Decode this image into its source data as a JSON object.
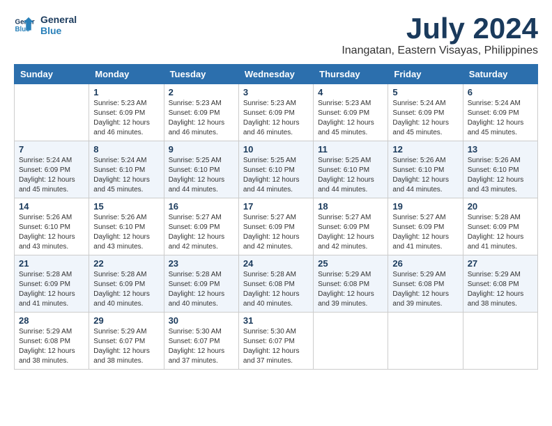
{
  "header": {
    "logo_line1": "General",
    "logo_line2": "Blue",
    "month": "July 2024",
    "location": "Inangatan, Eastern Visayas, Philippines"
  },
  "weekdays": [
    "Sunday",
    "Monday",
    "Tuesday",
    "Wednesday",
    "Thursday",
    "Friday",
    "Saturday"
  ],
  "weeks": [
    [
      {
        "day": "",
        "sunrise": "",
        "sunset": "",
        "daylight": ""
      },
      {
        "day": "1",
        "sunrise": "Sunrise: 5:23 AM",
        "sunset": "Sunset: 6:09 PM",
        "daylight": "Daylight: 12 hours and 46 minutes."
      },
      {
        "day": "2",
        "sunrise": "Sunrise: 5:23 AM",
        "sunset": "Sunset: 6:09 PM",
        "daylight": "Daylight: 12 hours and 46 minutes."
      },
      {
        "day": "3",
        "sunrise": "Sunrise: 5:23 AM",
        "sunset": "Sunset: 6:09 PM",
        "daylight": "Daylight: 12 hours and 46 minutes."
      },
      {
        "day": "4",
        "sunrise": "Sunrise: 5:23 AM",
        "sunset": "Sunset: 6:09 PM",
        "daylight": "Daylight: 12 hours and 45 minutes."
      },
      {
        "day": "5",
        "sunrise": "Sunrise: 5:24 AM",
        "sunset": "Sunset: 6:09 PM",
        "daylight": "Daylight: 12 hours and 45 minutes."
      },
      {
        "day": "6",
        "sunrise": "Sunrise: 5:24 AM",
        "sunset": "Sunset: 6:09 PM",
        "daylight": "Daylight: 12 hours and 45 minutes."
      }
    ],
    [
      {
        "day": "7",
        "sunrise": "Sunrise: 5:24 AM",
        "sunset": "Sunset: 6:09 PM",
        "daylight": "Daylight: 12 hours and 45 minutes."
      },
      {
        "day": "8",
        "sunrise": "Sunrise: 5:24 AM",
        "sunset": "Sunset: 6:10 PM",
        "daylight": "Daylight: 12 hours and 45 minutes."
      },
      {
        "day": "9",
        "sunrise": "Sunrise: 5:25 AM",
        "sunset": "Sunset: 6:10 PM",
        "daylight": "Daylight: 12 hours and 44 minutes."
      },
      {
        "day": "10",
        "sunrise": "Sunrise: 5:25 AM",
        "sunset": "Sunset: 6:10 PM",
        "daylight": "Daylight: 12 hours and 44 minutes."
      },
      {
        "day": "11",
        "sunrise": "Sunrise: 5:25 AM",
        "sunset": "Sunset: 6:10 PM",
        "daylight": "Daylight: 12 hours and 44 minutes."
      },
      {
        "day": "12",
        "sunrise": "Sunrise: 5:26 AM",
        "sunset": "Sunset: 6:10 PM",
        "daylight": "Daylight: 12 hours and 44 minutes."
      },
      {
        "day": "13",
        "sunrise": "Sunrise: 5:26 AM",
        "sunset": "Sunset: 6:10 PM",
        "daylight": "Daylight: 12 hours and 43 minutes."
      }
    ],
    [
      {
        "day": "14",
        "sunrise": "Sunrise: 5:26 AM",
        "sunset": "Sunset: 6:10 PM",
        "daylight": "Daylight: 12 hours and 43 minutes."
      },
      {
        "day": "15",
        "sunrise": "Sunrise: 5:26 AM",
        "sunset": "Sunset: 6:10 PM",
        "daylight": "Daylight: 12 hours and 43 minutes."
      },
      {
        "day": "16",
        "sunrise": "Sunrise: 5:27 AM",
        "sunset": "Sunset: 6:09 PM",
        "daylight": "Daylight: 12 hours and 42 minutes."
      },
      {
        "day": "17",
        "sunrise": "Sunrise: 5:27 AM",
        "sunset": "Sunset: 6:09 PM",
        "daylight": "Daylight: 12 hours and 42 minutes."
      },
      {
        "day": "18",
        "sunrise": "Sunrise: 5:27 AM",
        "sunset": "Sunset: 6:09 PM",
        "daylight": "Daylight: 12 hours and 42 minutes."
      },
      {
        "day": "19",
        "sunrise": "Sunrise: 5:27 AM",
        "sunset": "Sunset: 6:09 PM",
        "daylight": "Daylight: 12 hours and 41 minutes."
      },
      {
        "day": "20",
        "sunrise": "Sunrise: 5:28 AM",
        "sunset": "Sunset: 6:09 PM",
        "daylight": "Daylight: 12 hours and 41 minutes."
      }
    ],
    [
      {
        "day": "21",
        "sunrise": "Sunrise: 5:28 AM",
        "sunset": "Sunset: 6:09 PM",
        "daylight": "Daylight: 12 hours and 41 minutes."
      },
      {
        "day": "22",
        "sunrise": "Sunrise: 5:28 AM",
        "sunset": "Sunset: 6:09 PM",
        "daylight": "Daylight: 12 hours and 40 minutes."
      },
      {
        "day": "23",
        "sunrise": "Sunrise: 5:28 AM",
        "sunset": "Sunset: 6:09 PM",
        "daylight": "Daylight: 12 hours and 40 minutes."
      },
      {
        "day": "24",
        "sunrise": "Sunrise: 5:28 AM",
        "sunset": "Sunset: 6:08 PM",
        "daylight": "Daylight: 12 hours and 40 minutes."
      },
      {
        "day": "25",
        "sunrise": "Sunrise: 5:29 AM",
        "sunset": "Sunset: 6:08 PM",
        "daylight": "Daylight: 12 hours and 39 minutes."
      },
      {
        "day": "26",
        "sunrise": "Sunrise: 5:29 AM",
        "sunset": "Sunset: 6:08 PM",
        "daylight": "Daylight: 12 hours and 39 minutes."
      },
      {
        "day": "27",
        "sunrise": "Sunrise: 5:29 AM",
        "sunset": "Sunset: 6:08 PM",
        "daylight": "Daylight: 12 hours and 38 minutes."
      }
    ],
    [
      {
        "day": "28",
        "sunrise": "Sunrise: 5:29 AM",
        "sunset": "Sunset: 6:08 PM",
        "daylight": "Daylight: 12 hours and 38 minutes."
      },
      {
        "day": "29",
        "sunrise": "Sunrise: 5:29 AM",
        "sunset": "Sunset: 6:07 PM",
        "daylight": "Daylight: 12 hours and 38 minutes."
      },
      {
        "day": "30",
        "sunrise": "Sunrise: 5:30 AM",
        "sunset": "Sunset: 6:07 PM",
        "daylight": "Daylight: 12 hours and 37 minutes."
      },
      {
        "day": "31",
        "sunrise": "Sunrise: 5:30 AM",
        "sunset": "Sunset: 6:07 PM",
        "daylight": "Daylight: 12 hours and 37 minutes."
      },
      {
        "day": "",
        "sunrise": "",
        "sunset": "",
        "daylight": ""
      },
      {
        "day": "",
        "sunrise": "",
        "sunset": "",
        "daylight": ""
      },
      {
        "day": "",
        "sunrise": "",
        "sunset": "",
        "daylight": ""
      }
    ]
  ]
}
